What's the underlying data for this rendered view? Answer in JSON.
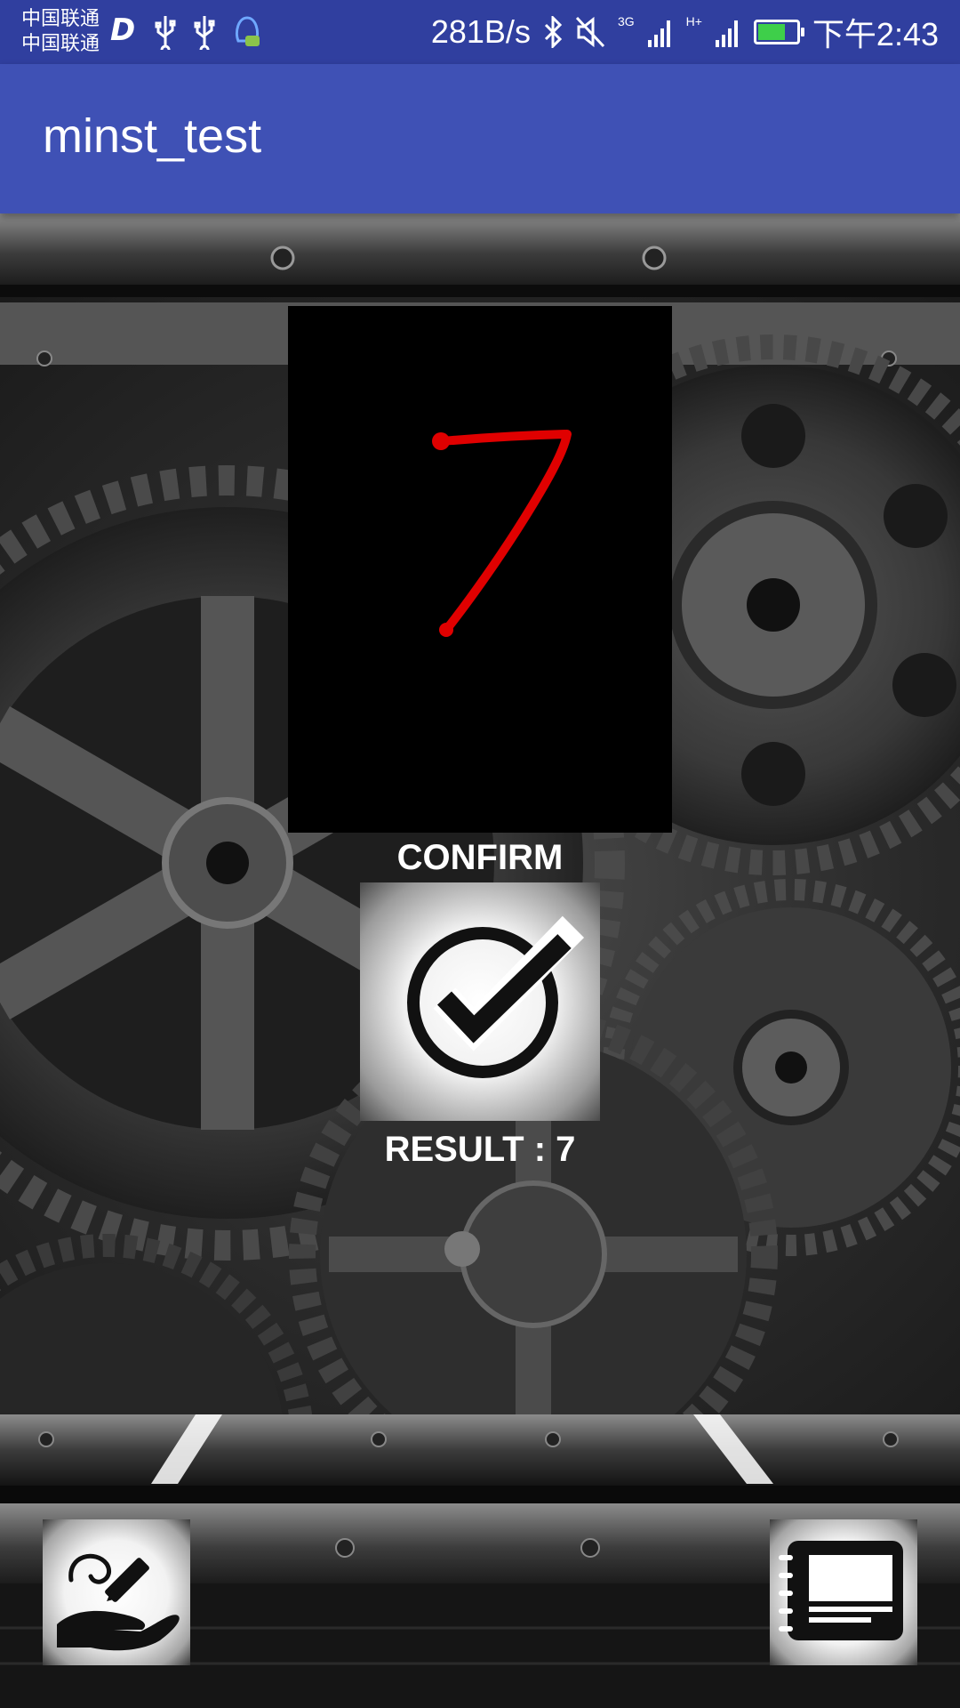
{
  "status_bar": {
    "carrier_line1": "中国联通",
    "carrier_line2": "中国联通",
    "net_speed": "281B/s",
    "signal_3g": "3G",
    "signal_h": "H+",
    "time": "下午2:43",
    "battery_level": 0.65,
    "icons": [
      "d-app-icon",
      "usb-icon",
      "usb-icon",
      "qq-icon",
      "bluetooth-icon",
      "mute-icon",
      "signal-icon",
      "battery-icon"
    ]
  },
  "app_bar": {
    "title": "minst_test"
  },
  "canvas": {
    "drawn_digit_color": "#e00000",
    "background_color": "#000000"
  },
  "confirm": {
    "label": "CONFIRM",
    "icon": "checkmark-circle-icon"
  },
  "result": {
    "label": "RESULT :  7"
  },
  "bottom_actions": {
    "left_icon": "draw-hand-icon",
    "right_icon": "notebook-icon"
  },
  "colors": {
    "status_bar": "#303f9f",
    "app_bar": "#3f51b5",
    "text": "#ffffff"
  }
}
